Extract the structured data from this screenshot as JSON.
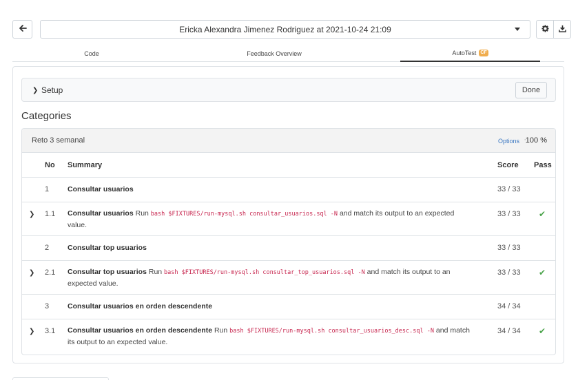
{
  "header": {
    "title": "Ericka Alexandra Jimenez Rodriguez at 2021-10-24 21:09",
    "back_icon": "arrow-left-icon",
    "settings_icon": "gear-icon",
    "download_icon": "download-icon"
  },
  "tabs": [
    {
      "label": "Code"
    },
    {
      "label": "Feedback Overview"
    },
    {
      "label": "AutoTest",
      "badge": "CF",
      "active": true
    }
  ],
  "setup": {
    "label": "Setup",
    "done_label": "Done"
  },
  "categories_heading": "Categories",
  "category": {
    "name": "Reto 3 semanal",
    "options_label": "Options",
    "separator": "·",
    "percentage": "100 %"
  },
  "table": {
    "headers": {
      "no": "No",
      "summary": "Summary",
      "score": "Score",
      "pass": "Pass"
    },
    "rows": [
      {
        "no": "1",
        "title": "Consultar usuarios",
        "score": "33 / 33"
      },
      {
        "no": "1.1",
        "title": "Consultar usuarios",
        "run": "Run",
        "command": "bash $FIXTURES/run-mysql.sh consultar_usuarios.sql -N",
        "suffix": "and match its output to an expected value.",
        "score": "33 / 33",
        "pass": "✔"
      },
      {
        "no": "2",
        "title": "Consultar top usuarios",
        "score": "33 / 33"
      },
      {
        "no": "2.1",
        "title": "Consultar top usuarios",
        "run": "Run",
        "command": "bash $FIXTURES/run-mysql.sh consultar_top_usuarios.sql -N",
        "suffix": "and match its output to an expected value.",
        "score": "33 / 33",
        "pass": "✔"
      },
      {
        "no": "3",
        "title": "Consultar usuarios en orden descendente",
        "score": "34 / 34"
      },
      {
        "no": "3.1",
        "title": "Consultar usuarios en orden descendente",
        "run": "Run",
        "command": "bash $FIXTURES/run-mysql.sh consultar_usuarios_desc.sql -N",
        "suffix": "and match its output to an expected value.",
        "score": "34 / 34",
        "pass": "✔"
      }
    ]
  },
  "colors": {
    "pass": "#4aa34a",
    "code": "#c7254e",
    "link": "#3c78c2",
    "badge": "#f0ad4e"
  }
}
